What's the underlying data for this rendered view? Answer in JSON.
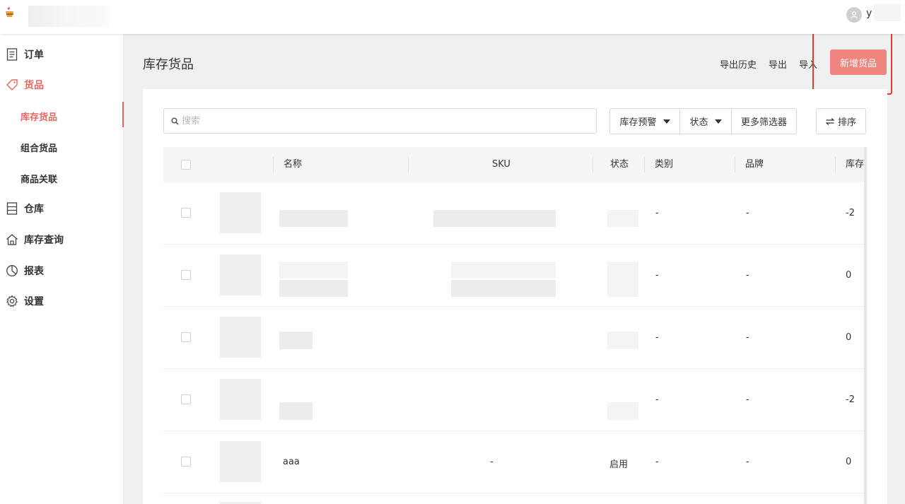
{
  "header": {
    "user_initial": "y"
  },
  "sidebar": {
    "items": [
      {
        "label": "订单",
        "icon": "order-icon"
      },
      {
        "label": "货品",
        "icon": "tag-icon"
      },
      {
        "label": "仓库",
        "icon": "warehouse-icon"
      },
      {
        "label": "库存查询",
        "icon": "home-icon"
      },
      {
        "label": "报表",
        "icon": "pie-chart-icon"
      },
      {
        "label": "设置",
        "icon": "gear-icon"
      }
    ],
    "sub_items": [
      "库存货品",
      "组合货品",
      "商品关联"
    ]
  },
  "page": {
    "title": "库存货品",
    "actions": [
      "导出历史",
      "导出",
      "导入"
    ],
    "add_button": "新增货品"
  },
  "toolbar": {
    "search_placeholder": "搜索",
    "filters": [
      "库存预警",
      "状态",
      "更多筛选器"
    ],
    "sort_label": "排序"
  },
  "table": {
    "columns": [
      "名称",
      "SKU",
      "状态",
      "类别",
      "品牌",
      "库存"
    ],
    "rows": [
      {
        "name": "",
        "sku": "",
        "status": "",
        "category": "-",
        "brand": "-",
        "stock": "-2"
      },
      {
        "name": "",
        "sku": "",
        "status": "",
        "category": "-",
        "brand": "-",
        "stock": "0"
      },
      {
        "name": "",
        "sku": "",
        "status": "",
        "category": "-",
        "brand": "-",
        "stock": "0"
      },
      {
        "name": "",
        "sku": "",
        "status": "",
        "category": "-",
        "brand": "-",
        "stock": "-2"
      },
      {
        "name": "aaa",
        "sku": "-",
        "status": "启用",
        "category": "-",
        "brand": "-",
        "stock": "0"
      }
    ]
  },
  "colors": {
    "accent": "#e8665f",
    "button": "#ef857e",
    "highlight": "#e53935"
  }
}
